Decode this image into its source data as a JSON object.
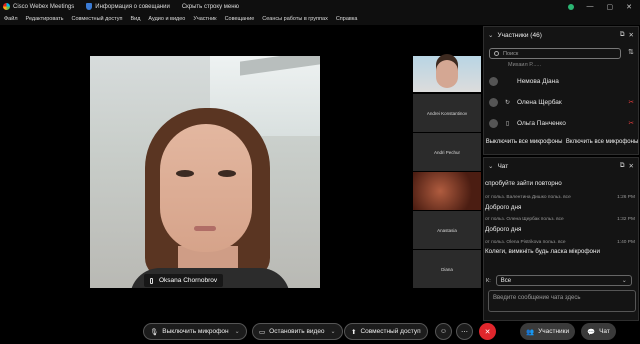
{
  "titlebar": {
    "app_name": "Cisco Webex Meetings",
    "meeting_info": "Информация о совещании",
    "hide_menu": "Скрыть строку меню"
  },
  "menu": [
    "Файл",
    "Редактировать",
    "Совместный доступ",
    "Вид",
    "Аудио и видео",
    "Участник",
    "Совещание",
    "Сеансы работы в группах",
    "Справка"
  ],
  "main_video": {
    "name": "Oksana Chornobrov"
  },
  "thumbnails": [
    {
      "name": ""
    },
    {
      "name": "Andrei Konstantinov"
    },
    {
      "name": "Andri Pechur"
    },
    {
      "name": ""
    },
    {
      "name": "Anastasia"
    },
    {
      "name": "Diana"
    }
  ],
  "participants": {
    "title": "Участники (46)",
    "search_placeholder": "Поиск",
    "partial_row": "Михаил Р......",
    "rows": [
      {
        "name": "Немова Діана",
        "status": ""
      },
      {
        "name": "Олена Щербак",
        "status": "↻"
      },
      {
        "name": "Ольга Панченко",
        "status": "▯"
      }
    ],
    "mute_all": "Выключить все микрофоны",
    "unmute_all": "Включить все микрофоны"
  },
  "chat": {
    "title": "Чат",
    "first_line": "спробуйте зайти повторно",
    "messages": [
      {
        "meta": "от польз. Валентина Дишко польз. все",
        "time": "1:26 PM",
        "text": "Доброго дня"
      },
      {
        "meta": "от польз. Олена Щербак польз. все",
        "time": "1:32 PM",
        "text": "Доброго дня"
      },
      {
        "meta": "от польз. Olena Pistrikova польз. все",
        "time": "1:40 PM",
        "text": "Колеги, вимкніть будь ласка мікрофони"
      }
    ],
    "to_label": "К:",
    "to_value": "Все",
    "input_placeholder": "Введите сообщение чата здесь"
  },
  "toolbar": {
    "mic": "Выключить микрофон",
    "video": "Остановить видео",
    "share": "Совместный доступ",
    "participants": "Участники",
    "chat": "Чат"
  },
  "colors": {
    "end_call": "#e0262c",
    "mute_red": "#e23c3c"
  }
}
